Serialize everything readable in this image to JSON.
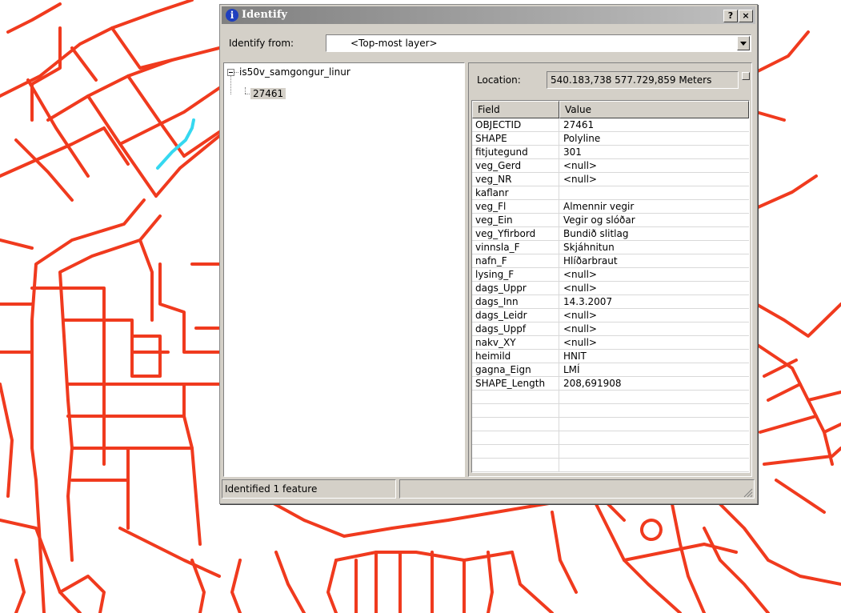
{
  "window": {
    "title": "Identify",
    "help_label": "?",
    "close_label": "×"
  },
  "identify_from": {
    "label": "Identify from:",
    "value": "<Top-most layer>"
  },
  "tree": {
    "layer": "is50v_samgongur_linur",
    "expander": "−",
    "feature_id": "27461"
  },
  "location": {
    "label": "Location:",
    "value": "540.183,738  577.729,859 Meters"
  },
  "attributes": {
    "headers": [
      "Field",
      "Value"
    ],
    "rows": [
      [
        "OBJECTID",
        "27461"
      ],
      [
        "SHAPE",
        "Polyline"
      ],
      [
        "fitjutegund",
        "301"
      ],
      [
        "veg_Gerd",
        "<null>"
      ],
      [
        "veg_NR",
        "<null>"
      ],
      [
        "kaflanr",
        ""
      ],
      [
        "veg_Fl",
        "Almennir vegir"
      ],
      [
        "veg_Ein",
        "Vegir og slóðar"
      ],
      [
        "veg_Yfirbord",
        "Bundið slitlag"
      ],
      [
        "vinnsla_F",
        "Skjáhnitun"
      ],
      [
        "nafn_F",
        "Hlíðarbraut"
      ],
      [
        "lysing_F",
        "<null>"
      ],
      [
        "dags_Uppr",
        "<null>"
      ],
      [
        "dags_Inn",
        "14.3.2007"
      ],
      [
        "dags_Leidr",
        "<null>"
      ],
      [
        "dags_Uppf",
        "<null>"
      ],
      [
        "nakv_XY",
        "<null>"
      ],
      [
        "heimild",
        "HNIT"
      ],
      [
        "gagna_Eign",
        "LMÍ"
      ],
      [
        "SHAPE_Length",
        "208,691908"
      ]
    ]
  },
  "status": {
    "text": "Identified 1 feature"
  },
  "colors": {
    "road": "#f03a1e",
    "highlight": "#35d8f0"
  }
}
